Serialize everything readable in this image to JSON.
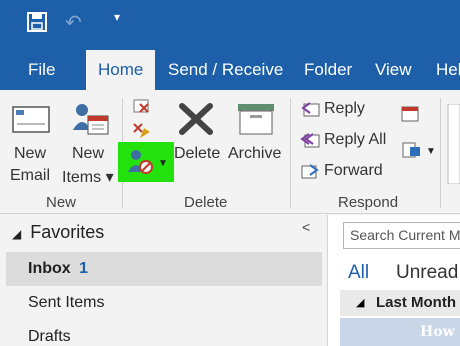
{
  "quick_access": {
    "save_icon": "save-icon",
    "undo_icon": "undo-icon",
    "more_glyph": "▾"
  },
  "tabs": [
    {
      "label": "File"
    },
    {
      "label": "Home"
    },
    {
      "label": "Send / Receive"
    },
    {
      "label": "Folder"
    },
    {
      "label": "View"
    },
    {
      "label": "Hel"
    }
  ],
  "ribbon": {
    "new_email": [
      "New",
      "Email"
    ],
    "new_items": [
      "New",
      "Items ▾"
    ],
    "new_group_label": "New",
    "delete_label": "Delete",
    "archive_label": "Archive",
    "delete_group_label": "Delete",
    "reply_label": "Reply",
    "reply_all_label": "Reply All",
    "forward_label": "Forward",
    "respond_group_label": "Respond"
  },
  "nav": {
    "collapse_glyph": "<",
    "favorites_label": "Favorites",
    "inbox_label": "Inbox",
    "inbox_count": "1",
    "sent_label": "Sent Items",
    "drafts_label": "Drafts"
  },
  "message_list": {
    "search_placeholder": "Search Current M",
    "filter_all": "All",
    "filter_unread": "Unread",
    "group_label": "Last Month"
  },
  "colors": {
    "brand_blue": "#1d5fa8",
    "highlight_green": "#22e10c"
  }
}
